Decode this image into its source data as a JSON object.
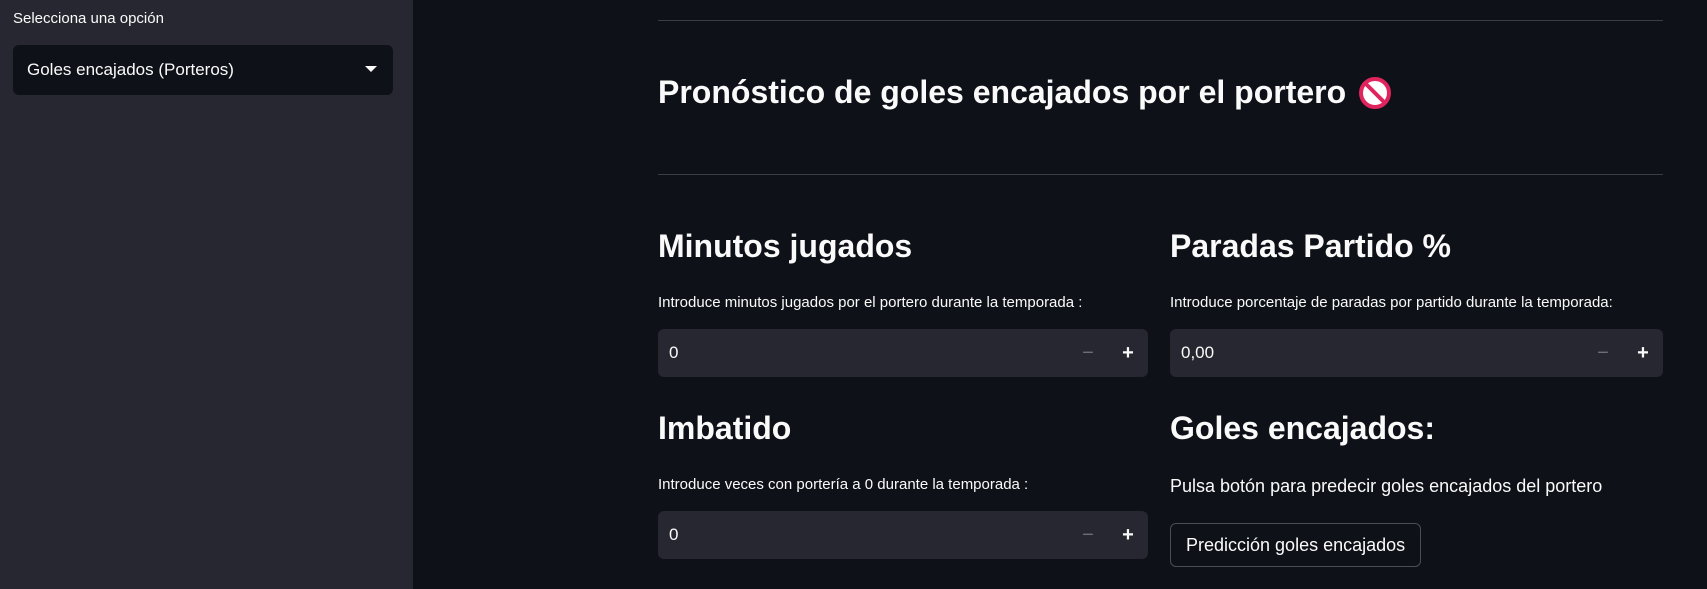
{
  "sidebar": {
    "select_label": "Selecciona una opción",
    "select_value": "Goles encajados (Porteros)"
  },
  "main": {
    "title": "Pronóstico de goles encajados por el portero",
    "title_icon": "no-entry-icon",
    "sections": {
      "minutos": {
        "heading": "Minutos jugados",
        "label": "Introduce minutos jugados por el portero durante la temporada :",
        "value": "0"
      },
      "paradas": {
        "heading": "Paradas Partido %",
        "label": "Introduce porcentaje de paradas por partido durante la temporada:",
        "value": "0,00"
      },
      "imbatido": {
        "heading": "Imbatido",
        "label": "Introduce veces con portería a 0 durante la temporada :",
        "value": "0"
      },
      "goles": {
        "heading": "Goles encajados:",
        "hint": "Pulsa botón para predecir goles encajados del portero",
        "button_label": "Predicción goles encajados"
      }
    },
    "stepper": {
      "minus": "−",
      "plus": "+"
    }
  },
  "colors": {
    "background": "#0e1117",
    "sidebar": "#262730",
    "input_bg": "#262730",
    "text": "#fafafa",
    "icon_red": "#e0245e"
  }
}
